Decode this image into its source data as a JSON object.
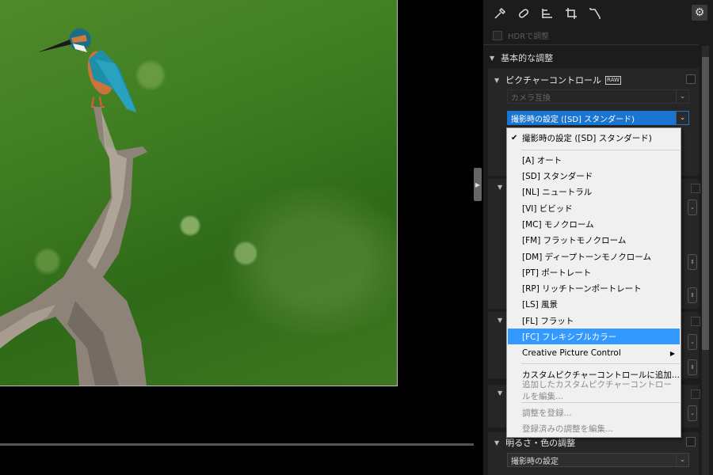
{
  "toolbar": {
    "icons": [
      "eyedropper-icon",
      "bandage-icon",
      "level-icon",
      "crop-icon",
      "perspective-icon",
      "gear-icon"
    ]
  },
  "hdr": {
    "label": "HDRで調整",
    "checked": false
  },
  "section_basic": {
    "title": "基本的な調整"
  },
  "picture_control": {
    "title": "ピクチャーコントロール",
    "badge": "RAW",
    "compat_select": "カメラ互換",
    "current_select": "撮影時の設定 ([SD] スタンダード)"
  },
  "menu": {
    "items": [
      {
        "label": "撮影時の設定 ([SD] スタンダード)",
        "checked": true
      },
      {
        "label": "[A] オート"
      },
      {
        "label": "[SD] スタンダード"
      },
      {
        "label": "[NL] ニュートラル"
      },
      {
        "label": "[VI] ビビッド"
      },
      {
        "label": "[MC] モノクローム"
      },
      {
        "label": "[FM] フラットモノクローム"
      },
      {
        "label": "[DM] ディープトーンモノクローム"
      },
      {
        "label": "[PT] ポートレート"
      },
      {
        "label": "[RP] リッチトーンポートレート"
      },
      {
        "label": "[LS] 風景"
      },
      {
        "label": "[FL] フラット"
      },
      {
        "label": "[FC] フレキシブルカラー",
        "highlighted": true
      },
      {
        "label": "Creative Picture Control",
        "submenu": true
      },
      {
        "label": "カスタムピクチャーコントロールに追加..."
      },
      {
        "label": "追加したカスタムピクチャーコントロールを編集...",
        "disabled": true
      },
      {
        "label": "調整を登録...",
        "disabled": true
      },
      {
        "label": "登録済みの調整を編集...",
        "disabled": true
      }
    ]
  },
  "brightness": {
    "title": "明るさ・色の調整",
    "select": "撮影時の設定"
  },
  "colors": {
    "accent": "#1a75d2",
    "menu_highlight": "#3399ff"
  }
}
